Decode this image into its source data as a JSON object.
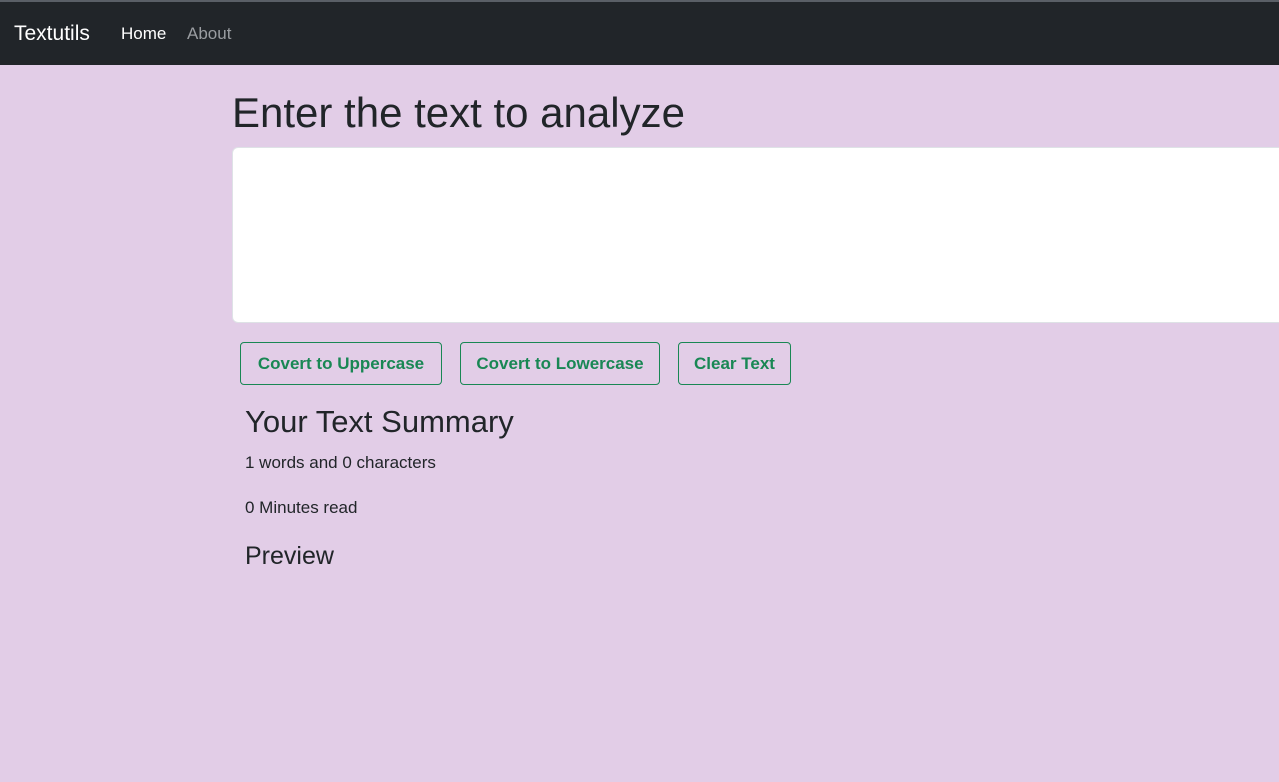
{
  "navbar": {
    "brand": "Textutils",
    "links": [
      {
        "label": "Home",
        "active": true
      },
      {
        "label": "About",
        "active": false
      }
    ],
    "background": "#212529"
  },
  "main": {
    "heading": "Enter the text to analyze",
    "textarea": {
      "value": "",
      "placeholder": ""
    },
    "buttons": {
      "uppercase": "Covert to Uppercase",
      "lowercase": "Covert to Lowercase",
      "clear": "Clear Text"
    },
    "button_color": "#198754",
    "page_background": "#e2cde7"
  },
  "summary": {
    "title": "Your Text Summary",
    "words_line": "1 words and 0 characters",
    "minutes_line": "0 Minutes read",
    "preview_title": "Preview",
    "preview_text": ""
  }
}
